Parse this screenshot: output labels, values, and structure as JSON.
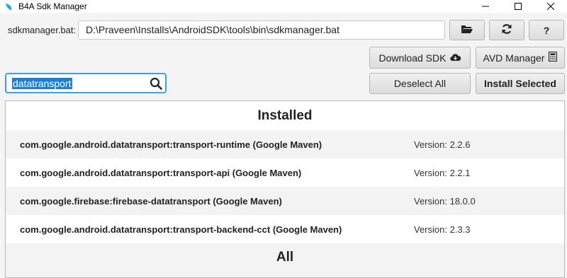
{
  "window": {
    "title": "B4A Sdk Manager",
    "minimize_symbol": "—",
    "maximize_symbol": "☐",
    "close_symbol": "✕"
  },
  "toolbar": {
    "sdkmanager_label": "sdkmanager.bat:",
    "sdkmanager_path": "D:\\Praveen\\Installs\\AndroidSDK\\tools\\bin\\sdkmanager.bat",
    "help_label": "?",
    "download_sdk_label": "Download SDK",
    "avd_manager_label": "AVD Manager",
    "deselect_all_label": "Deselect All",
    "install_selected_label": "Install Selected"
  },
  "search": {
    "value": "datatransport"
  },
  "installed": {
    "header": "Installed",
    "items": [
      {
        "name": "com.google.android.datatransport:transport-runtime (Google Maven)",
        "version": "Version: 2.2.6"
      },
      {
        "name": "com.google.android.datatransport:transport-api (Google Maven)",
        "version": "Version: 2.2.1"
      },
      {
        "name": "com.google.firebase:firebase-datatransport (Google Maven)",
        "version": "Version: 18.0.0"
      },
      {
        "name": "com.google.android.datatransport:transport-backend-cct (Google Maven)",
        "version": "Version: 2.3.3"
      }
    ]
  },
  "all": {
    "header": "All"
  },
  "colors": {
    "accent": "#3a9ff0",
    "selection": "#1e7fd2",
    "app_icon": "#2aa3e8"
  },
  "icons": [
    "app-logo-icon",
    "folder-open-icon",
    "refresh-icon",
    "cloud-download-icon",
    "calculator-icon",
    "search-icon"
  ]
}
